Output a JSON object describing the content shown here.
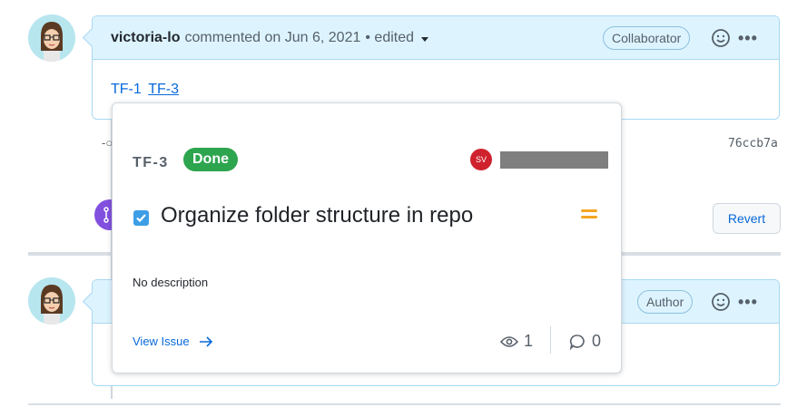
{
  "comment1": {
    "author": "victoria-lo",
    "meta": "commented on Jun 6, 2021",
    "edited": "• edited",
    "role": "Collaborator",
    "more": "•••",
    "links": [
      "TF-1",
      "TF-3"
    ]
  },
  "timeline": {
    "sha": "76ccb7a",
    "revert_label": "Revert"
  },
  "comment2": {
    "role": "Author",
    "more": "•••"
  },
  "popup": {
    "issue_key": "TF-3",
    "status": "Done",
    "assignee_initials": "SV",
    "title": "Organize folder structure in repo",
    "description": "No description",
    "view_issue_label": "View Issue",
    "watchers_count": "1",
    "comments_count": "0",
    "icons": {
      "checkbox": "task-checkbox-icon",
      "priority": "medium-priority-icon",
      "arrow": "arrow-right-icon",
      "eye": "eye-icon",
      "comment": "comment-icon"
    }
  },
  "colors": {
    "header_bg": "#ddf4ff",
    "border": "#a9d9f3",
    "link": "#0969da",
    "done_badge": "#2da44e",
    "priority": "#f5a623",
    "merge": "#8250df"
  }
}
